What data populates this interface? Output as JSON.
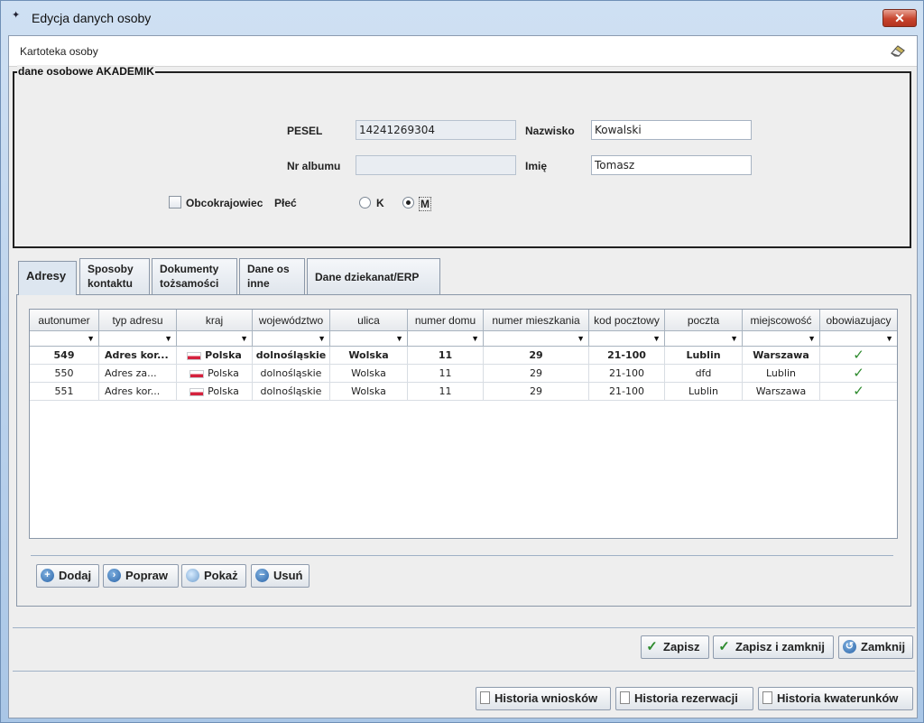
{
  "window": {
    "title": "Edycja danych osoby",
    "close_glyph": "✕"
  },
  "header": {
    "title": "Kartoteka osoby",
    "icon": "eraser-icon"
  },
  "personal": {
    "legend": "dane osobowe AKADEMIK",
    "pesel_label": "PESEL",
    "pesel_value": "14241269304",
    "nazwisko_label": "Nazwisko",
    "nazwisko_value": "Kowalski",
    "nralbumu_label": "Nr albumu",
    "nralbumu_value": "",
    "imie_label": "Imię",
    "imie_value": "Tomasz",
    "obcokrajowiec_label": "Obcokrajowiec",
    "obcokrajowiec_checked": false,
    "plec_label": "Płeć",
    "plec_k": "K",
    "plec_m": "M",
    "plec_selected": "M"
  },
  "tabs": [
    {
      "label": "Adresy"
    },
    {
      "label": "Sposoby kontaktu",
      "l1": "Sposoby",
      "l2": "kontaktu"
    },
    {
      "label": "Dokumenty tożsamości",
      "l1": "Dokumenty",
      "l2": "tożsamości"
    },
    {
      "label": "Dane os inne",
      "l1": "Dane os",
      "l2": "inne"
    },
    {
      "label": "Dane dziekanat/ERP"
    }
  ],
  "grid": {
    "columns": [
      "autonumer",
      "typ adresu",
      "kraj",
      "województwo",
      "ulica",
      "numer domu",
      "numer mieszkania",
      "kod pocztowy",
      "poczta",
      "miejscowość",
      "obowiazujacy"
    ],
    "filter_glyph": "▼",
    "rows": [
      [
        "549",
        "Adres kor...",
        "Polska",
        "dolnośląskie",
        "Wolska",
        "11",
        "29",
        "21-100",
        "Lublin",
        "Warszawa",
        "✓"
      ],
      [
        "550",
        "Adres za...",
        "Polska",
        "dolnośląskie",
        "Wolska",
        "11",
        "29",
        "21-100",
        "dfd",
        "Lublin",
        "✓"
      ],
      [
        "551",
        "Adres kor...",
        "Polska",
        "dolnośląskie",
        "Wolska",
        "11",
        "29",
        "21-100",
        "Lublin",
        "Warszawa",
        "✓"
      ]
    ]
  },
  "actions": {
    "dodaj": "Dodaj",
    "popraw": "Popraw",
    "pokaz": "Pokaż",
    "usun": "Usuń"
  },
  "footer": {
    "zapisz": "Zapisz",
    "zapisz_zamknij": "Zapisz i zamknij",
    "zamknij": "Zamknij",
    "hist_wnioskow": "Historia wniosków",
    "hist_rezerwacji": "Historia rezerwacji",
    "hist_kwaterunkow": "Historia kwaterunków"
  }
}
